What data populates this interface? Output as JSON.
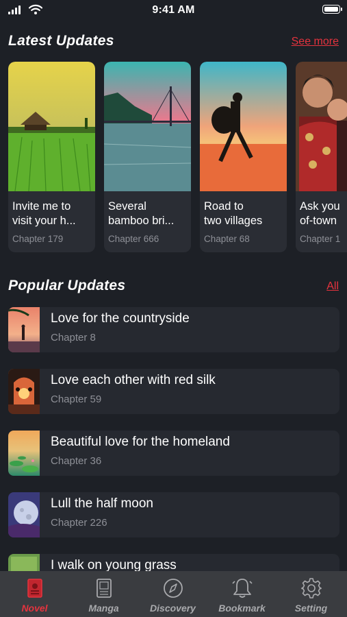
{
  "status_bar": {
    "time": "9:41 AM"
  },
  "latest": {
    "title": "Latest Updates",
    "link": "See more",
    "cards": [
      {
        "title": "Invite me to\nvisit your h...",
        "chapter": "Chapter 179",
        "icon": "rice-field-hut"
      },
      {
        "title": "Several\nbamboo bri...",
        "chapter": "Chapter 666",
        "icon": "lake-bridge"
      },
      {
        "title": "Road to\ntwo villages",
        "chapter": "Chapter 68",
        "icon": "walker-sunset"
      },
      {
        "title": "Ask you\nof-town",
        "chapter": "Chapter 1",
        "icon": "couple-portrait"
      }
    ]
  },
  "popular": {
    "title": "Popular Updates",
    "link": "All",
    "items": [
      {
        "title": "Love for the countryside",
        "chapter": "Chapter 8"
      },
      {
        "title": "Love each other with red silk",
        "chapter": "Chapter 59"
      },
      {
        "title": "Beautiful love for the homeland",
        "chapter": "Chapter 36"
      },
      {
        "title": "Lull the half moon",
        "chapter": "Chapter 226"
      },
      {
        "title": "I walk on young grass",
        "chapter": ""
      }
    ]
  },
  "tabs": [
    {
      "label": "Novel",
      "icon": "book-icon",
      "active": true
    },
    {
      "label": "Manga",
      "icon": "manga-icon",
      "active": false
    },
    {
      "label": "Discovery",
      "icon": "compass-icon",
      "active": false
    },
    {
      "label": "Bookmark",
      "icon": "bell-icon",
      "active": false
    },
    {
      "label": "Setting",
      "icon": "gear-icon",
      "active": false
    }
  ],
  "colors": {
    "accent": "#e5333e",
    "background": "#1d2026",
    "card": "#2a2d34",
    "tabbar": "#3a3c40"
  }
}
